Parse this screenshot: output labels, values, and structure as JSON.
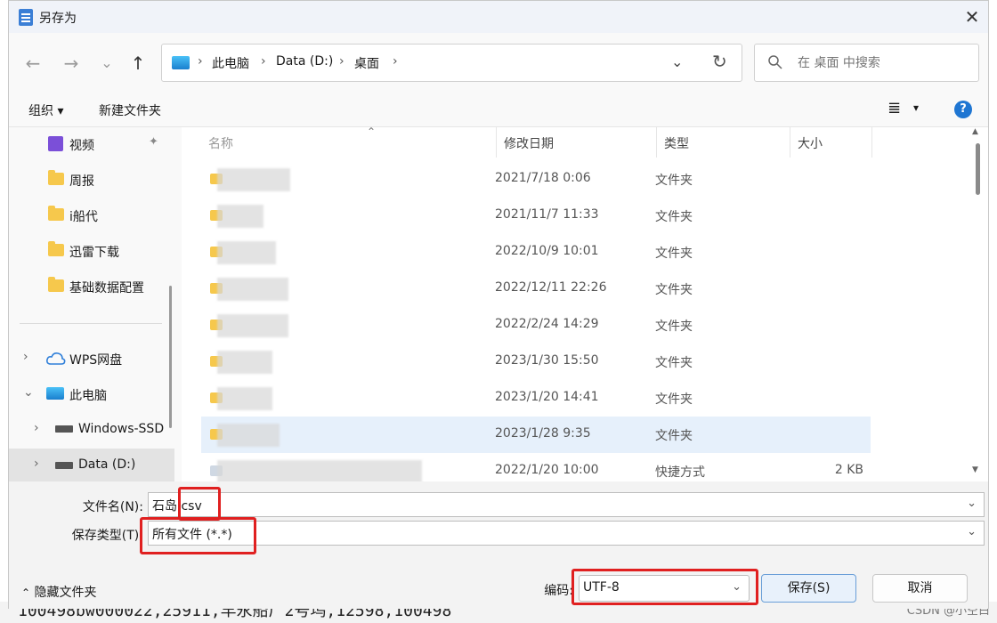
{
  "title": "另存为",
  "close_glyph": "✕",
  "nav": {
    "back": "←",
    "forward": "→",
    "recent": "⌄",
    "up": "↑",
    "refresh": "↻",
    "addr_dropdown": "⌄",
    "chevron": "›"
  },
  "breadcrumb": [
    "此电脑",
    "Data (D:)",
    "桌面"
  ],
  "search_placeholder": "在 桌面 中搜索",
  "toolbar": {
    "organize": "组织 ▾",
    "new_folder": "新建文件夹",
    "view_glyph": "≣",
    "view_dd": "▾",
    "help": "?"
  },
  "sidebar": {
    "pin_glyph": "📌",
    "quick": [
      "视频",
      "周报",
      "i船代",
      "迅雷下载",
      "基础数据配置"
    ],
    "wps": "WPS网盘",
    "pc": "此电脑",
    "drive_c": "Windows-SSD",
    "drive_d": "Data (D:)",
    "arrow_right": "›",
    "arrow_down": "⌄"
  },
  "columns": {
    "name": "名称",
    "date": "修改日期",
    "type": "类型",
    "size": "大小",
    "sort_glyph": "⌃"
  },
  "rows": [
    {
      "date": "2021/7/18 0:06",
      "type": "文件夹",
      "size": ""
    },
    {
      "date": "2021/11/7 11:33",
      "type": "文件夹",
      "size": ""
    },
    {
      "date": "2022/10/9 10:01",
      "type": "文件夹",
      "size": ""
    },
    {
      "date": "2022/12/11 22:26",
      "type": "文件夹",
      "size": ""
    },
    {
      "date": "2022/2/24 14:29",
      "type": "文件夹",
      "size": ""
    },
    {
      "date": "2023/1/30 15:50",
      "type": "文件夹",
      "size": ""
    },
    {
      "date": "2023/1/20 14:41",
      "type": "文件夹",
      "size": ""
    },
    {
      "date": "2023/1/28 9:35",
      "type": "文件夹",
      "size": ""
    },
    {
      "date": "2022/1/20 10:00",
      "type": "快捷方式",
      "size": "2 KB"
    }
  ],
  "filename": {
    "label": "文件名(N):",
    "value": "石岛.csv"
  },
  "filetype": {
    "label": "保存类型(T):",
    "value": "所有文件 (*.*)"
  },
  "encoding": {
    "label": "编码:",
    "value": "UTF-8"
  },
  "dropdown_glyph": "⌄",
  "buttons": {
    "save": "保存(S)",
    "cancel": "取消"
  },
  "hide_folders": {
    "glyph": "⌃",
    "label": "隐藏文件夹"
  },
  "bg_text": "100498bw000022,25911,羊永船厂2号坞,12598,100498",
  "watermark": "CSDN @小空白"
}
